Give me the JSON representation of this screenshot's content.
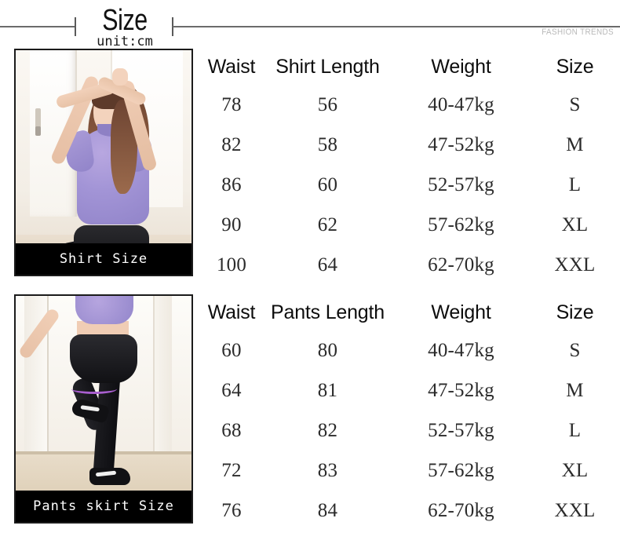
{
  "header": {
    "title": "Size",
    "unit": "unit:cm",
    "brand": "FASHION TRENDS"
  },
  "blocks": [
    {
      "id": "shirt",
      "photo_caption": "Shirt Size",
      "photo_alt": "model-wearing-lavender-short-sleeve-top",
      "table": {
        "headers": [
          "Waist",
          "Shirt Length",
          "Weight",
          "Size"
        ],
        "rows": [
          [
            "78",
            "56",
            "40-47kg",
            "S"
          ],
          [
            "82",
            "58",
            "47-52kg",
            "M"
          ],
          [
            "86",
            "60",
            "52-57kg",
            "L"
          ],
          [
            "90",
            "62",
            "57-62kg",
            "XL"
          ],
          [
            "100",
            "64",
            "62-70kg",
            "XXL"
          ]
        ]
      }
    },
    {
      "id": "pants",
      "photo_caption": "Pants skirt Size",
      "photo_alt": "model-wearing-black-pants-skirt-leggings",
      "table": {
        "headers": [
          "Waist",
          "Pants Length",
          "Weight",
          "Size"
        ],
        "rows": [
          [
            "60",
            "80",
            "40-47kg",
            "S"
          ],
          [
            "64",
            "81",
            "47-52kg",
            "M"
          ],
          [
            "68",
            "82",
            "52-57kg",
            "L"
          ],
          [
            "72",
            "83",
            "57-62kg",
            "XL"
          ],
          [
            "76",
            "84",
            "62-70kg",
            "XXL"
          ]
        ]
      }
    }
  ],
  "colors": {
    "background": "#ffffff",
    "text": "#111111",
    "caption_bar": "#000000",
    "caption_text": "#ffffff",
    "brand_text": "#b9b9b9",
    "rule": "#6b6b6b",
    "garment_accent": "#9184c9"
  }
}
